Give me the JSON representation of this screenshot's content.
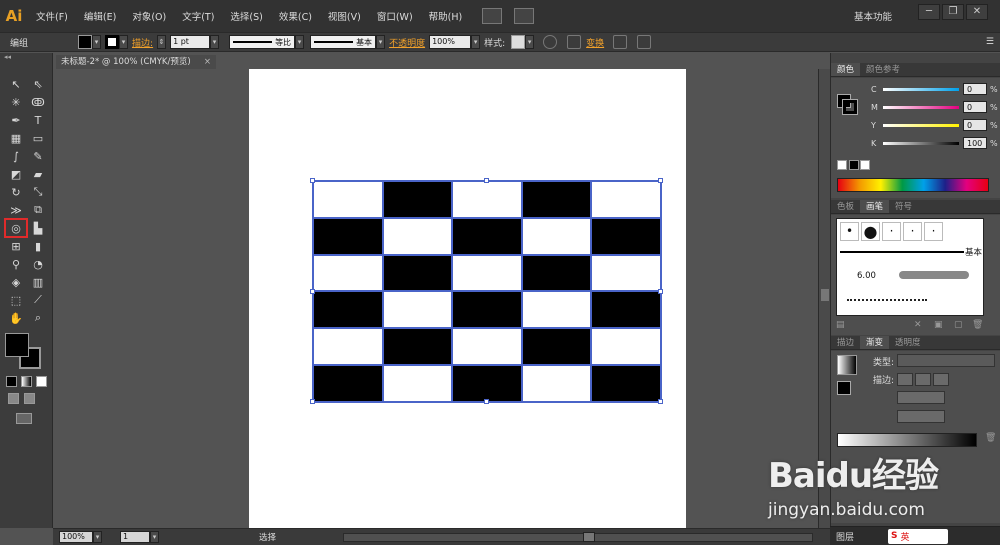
{
  "app": {
    "logo": "Ai"
  },
  "menubar": {
    "items": [
      "文件(F)",
      "编辑(E)",
      "对象(O)",
      "文字(T)",
      "选择(S)",
      "效果(C)",
      "视图(V)",
      "窗口(W)",
      "帮助(H)"
    ],
    "workspace": "基本功能",
    "win_min": "─",
    "win_restore": "❐",
    "win_close": "✕"
  },
  "controlbar": {
    "selection_label": "编组",
    "stroke_link": "描边:",
    "stroke_width": "1 pt",
    "stroke_profile": "等比",
    "brush_label": "基本",
    "opacity_link": "不透明度",
    "opacity_value": "100%",
    "style_label": "样式:",
    "transform_link": "变换"
  },
  "document": {
    "tab_title": "未标题-2* @ 100% (CMYK/预览)",
    "tab_close": "×",
    "artwork": "checkerboard",
    "checker_rows": 6,
    "checker_cols": 5,
    "colors": {
      "black": "#000000",
      "white": "#ffffff",
      "selection": "#4a64c8"
    }
  },
  "statusbar": {
    "zoom": "100%",
    "page": "1",
    "tool_name": "选择"
  },
  "panels": {
    "color": {
      "tabs": [
        "颜色",
        "颜色参考"
      ],
      "channels": [
        {
          "label": "C",
          "value": "0",
          "unit": "%"
        },
        {
          "label": "M",
          "value": "0",
          "unit": "%"
        },
        {
          "label": "Y",
          "value": "0",
          "unit": "%"
        },
        {
          "label": "K",
          "value": "100",
          "unit": "%"
        }
      ]
    },
    "brushes": {
      "tabs": [
        "色板",
        "画笔",
        "符号"
      ],
      "basic_label": "基本",
      "stroke_size": "6.00"
    },
    "gradient": {
      "tabs": [
        "描边",
        "渐变",
        "透明度"
      ],
      "type_label": "类型:",
      "stroke_label": "描边:"
    },
    "bottom": {
      "layers_tab": "图层"
    }
  },
  "watermark": {
    "brand": "Baidu经验",
    "url": "jingyan.baidu.com"
  },
  "taskbar": {
    "ime_label": "英"
  }
}
